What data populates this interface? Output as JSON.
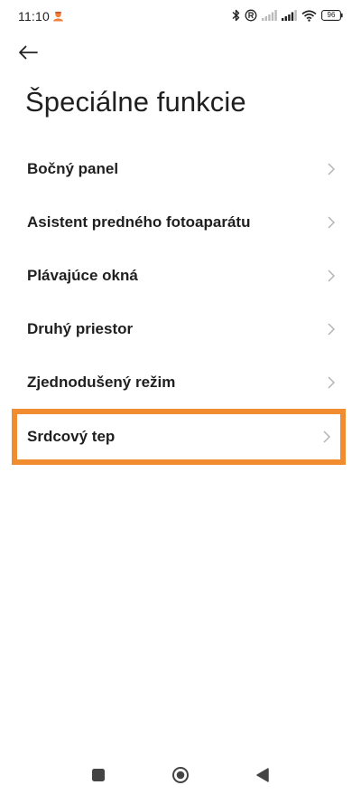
{
  "status_bar": {
    "time": "11:10",
    "battery_level": "96",
    "icons": [
      "notification-icon",
      "bluetooth-icon",
      "registered-icon",
      "signal-icon",
      "signal-icon",
      "wifi-icon",
      "battery-icon"
    ]
  },
  "header": {
    "back_icon": "arrow-left-icon",
    "title": "Špeciálne funkcie"
  },
  "menu": {
    "items": [
      {
        "label": "Bočný panel"
      },
      {
        "label": "Asistent predného fotoaparátu"
      },
      {
        "label": "Plávajúce okná"
      },
      {
        "label": "Druhý priestor"
      },
      {
        "label": "Zjednodušený režim"
      },
      {
        "label": "Srdcový tep",
        "highlighted": true
      }
    ]
  },
  "nav_bar": {
    "buttons": [
      "recent-apps-icon",
      "home-icon",
      "back-triangle-icon"
    ]
  },
  "colors": {
    "highlight": "#f28c30",
    "text": "#1f1f1f",
    "chevron": "#b5b5b5"
  }
}
